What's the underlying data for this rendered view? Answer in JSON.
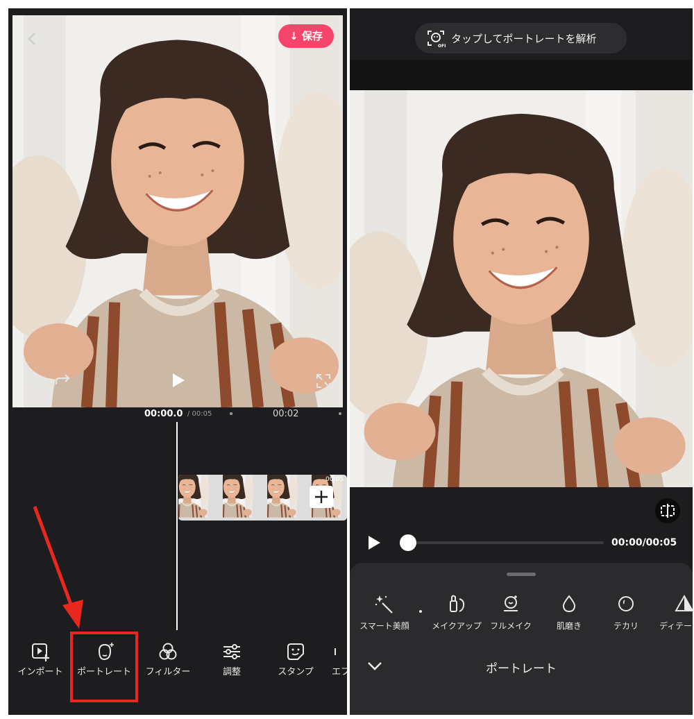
{
  "left": {
    "save_label": "↓ 保存",
    "back_icon": "chevron-left-icon",
    "undo_icon": "undo-icon",
    "redo_icon": "redo-icon",
    "play_icon": "play-icon",
    "fullscreen_icon": "fullscreen-icon",
    "timeline": {
      "current_time": "00:00.0",
      "total_time": "/ 00:05",
      "marker_time": "00:02",
      "clip_duration": "00:05",
      "add_icon": "plus-icon"
    },
    "toolbar": [
      {
        "label": "インポート",
        "icon": "import-icon"
      },
      {
        "label": "ポートレート",
        "icon": "portrait-face-icon"
      },
      {
        "label": "フィルター",
        "icon": "filter-circles-icon"
      },
      {
        "label": "調整",
        "icon": "sliders-icon"
      },
      {
        "label": "スタンプ",
        "icon": "sticker-icon"
      },
      {
        "label": "エフ",
        "icon": "effect-icon"
      }
    ],
    "highlight_color": "#e8271e",
    "save_color": "#f5456b"
  },
  "right": {
    "analyze_label": "タップしてポートレートを解析",
    "analyze_icon": "face-scan-off-icon",
    "compare_icon": "compare-icon",
    "playback": {
      "play_icon": "play-icon",
      "time": "00:00/00:05",
      "progress": 0
    },
    "tools": [
      {
        "label": "スマート美顔",
        "icon": "magic-wand-icon"
      },
      {
        "label": "メイクアップ",
        "icon": "makeup-icon"
      },
      {
        "label": "フルメイク",
        "icon": "full-makeup-icon"
      },
      {
        "label": "肌磨き",
        "icon": "droplet-icon"
      },
      {
        "label": "テカリ",
        "icon": "shine-face-icon"
      },
      {
        "label": "ディテー",
        "icon": "detail-triangle-icon"
      }
    ],
    "section_title": "ポートレート",
    "collapse_icon": "chevron-down-icon"
  }
}
